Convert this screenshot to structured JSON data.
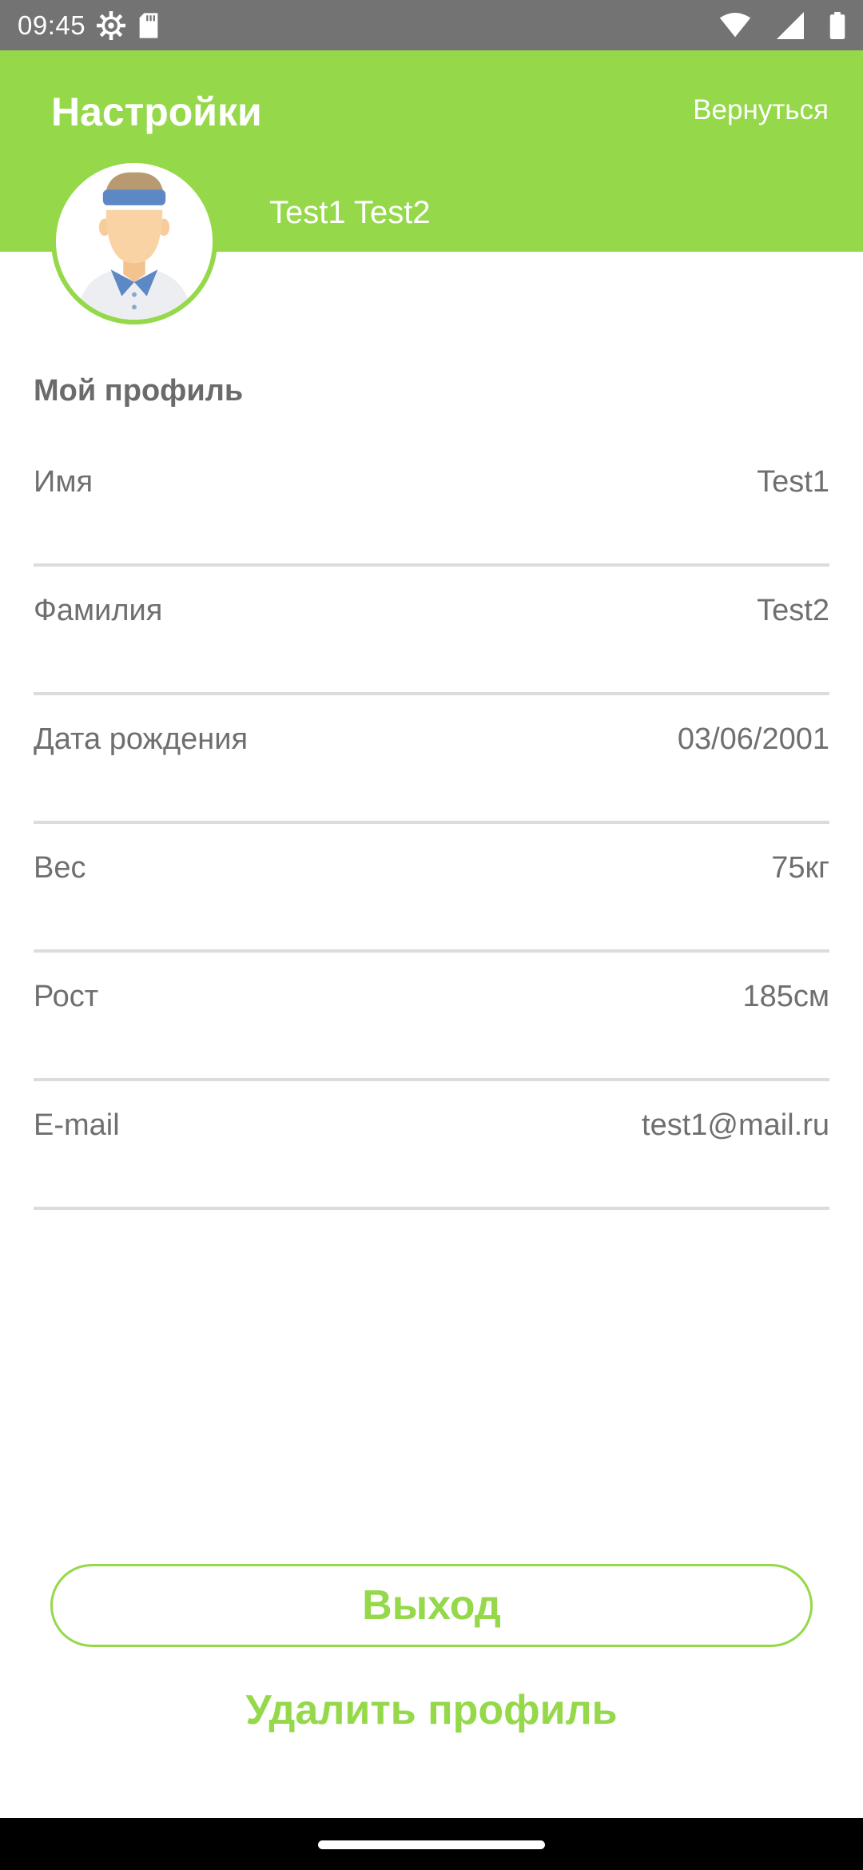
{
  "status_bar": {
    "time": "09:45",
    "icons": [
      "settings-gear-icon",
      "sd-card-icon",
      "wifi-icon",
      "signal-icon",
      "battery-icon"
    ]
  },
  "header": {
    "title": "Настройки",
    "back_label": "Вернуться",
    "user_name": "Test1 Test2"
  },
  "profile": {
    "section_title": "Мой профиль",
    "fields": [
      {
        "label": "Имя",
        "value": "Test1"
      },
      {
        "label": "Фамилия",
        "value": "Test2"
      },
      {
        "label": "Дата рождения",
        "value": "03/06/2001"
      },
      {
        "label": "Вес",
        "value": "75кг"
      },
      {
        "label": "Рост",
        "value": "185см"
      },
      {
        "label": "E-mail",
        "value": "test1@mail.ru"
      }
    ]
  },
  "actions": {
    "logout_label": "Выход",
    "delete_label": "Удалить профиль"
  },
  "colors": {
    "accent": "#95d84a",
    "status_bar": "#737373",
    "text_gray": "#6f6f6f",
    "divider": "#dcdcdc"
  }
}
